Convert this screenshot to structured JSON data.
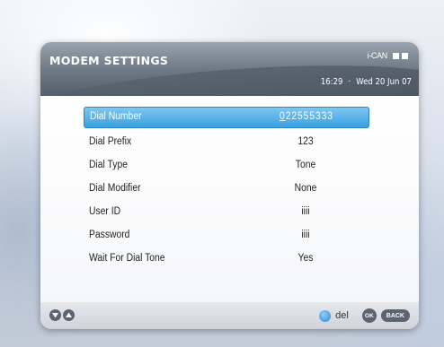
{
  "header": {
    "title": "MODEM SETTINGS",
    "brand": "i-CAN",
    "time": "16:29",
    "separator": "·",
    "date": "Wed 20 Jun 07"
  },
  "settings": {
    "rows": [
      {
        "label": "Dial Number",
        "value_first": "0",
        "value_rest": "22555333",
        "selected": true
      },
      {
        "label": "Dial Prefix",
        "value": "123"
      },
      {
        "label": "Dial Type",
        "value": "Tone"
      },
      {
        "label": "Dial Modifier",
        "value": "None"
      },
      {
        "label": "User ID",
        "value": "iiii"
      },
      {
        "label": "Password",
        "value": "iiii"
      },
      {
        "label": "Wait For Dial Tone",
        "value": "Yes"
      }
    ]
  },
  "footer": {
    "del_label": "del",
    "ok_label": "OK",
    "back_label": "BACK"
  },
  "colors": {
    "selection": "#39a0e0",
    "header_dark": "#55606c"
  },
  "icons": [
    "down-arrow-icon",
    "up-arrow-icon",
    "blue-button-icon",
    "ok-button-icon",
    "back-button-icon"
  ]
}
